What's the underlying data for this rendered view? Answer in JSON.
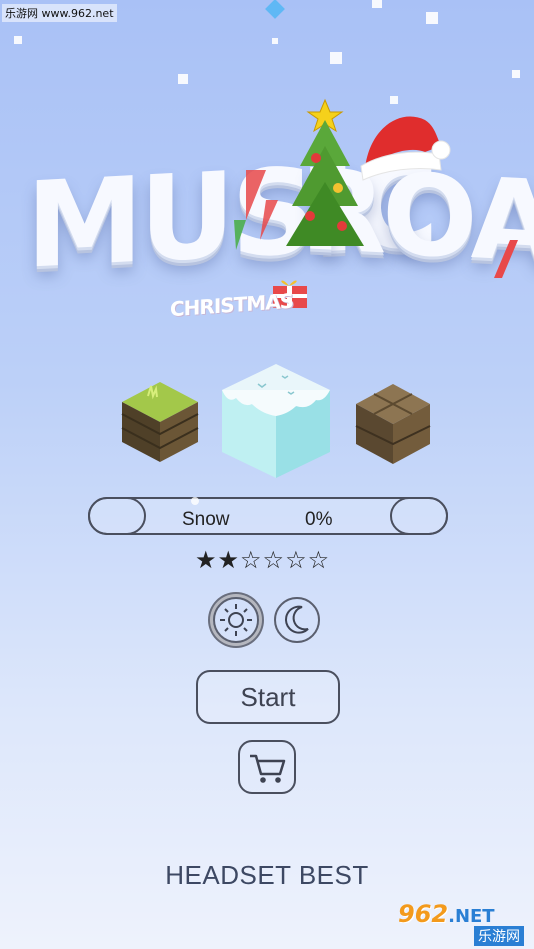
{
  "watermark": {
    "site_label": "乐游网 www.962.net"
  },
  "logo": {
    "word1": "MUSIC",
    "word2": "ROAD",
    "subtitle": "CHRISTMAS"
  },
  "themes": [
    {
      "name": "grass",
      "selected": false
    },
    {
      "name": "snow",
      "selected": true
    },
    {
      "name": "stone",
      "selected": false
    }
  ],
  "song": {
    "name": "Snow",
    "progress_label": "0%",
    "progress": 0,
    "difficulty_stars": "★★☆☆☆☆",
    "difficulty_filled": 2,
    "difficulty_total": 6
  },
  "modes": {
    "day_icon": "sun-icon",
    "night_icon": "moon-icon",
    "selected": "day"
  },
  "start_label": "Start",
  "shop_icon": "cart-icon",
  "footer_text": "HEADSET BEST",
  "badge": {
    "top": "962",
    "suffix": ".NET",
    "bottom": "乐游网"
  },
  "colors": {
    "bg_top": "#a9c1f6",
    "bg_bottom": "#eef2fc",
    "outline": "#4a4f5e",
    "footer_text": "#3d4863"
  }
}
